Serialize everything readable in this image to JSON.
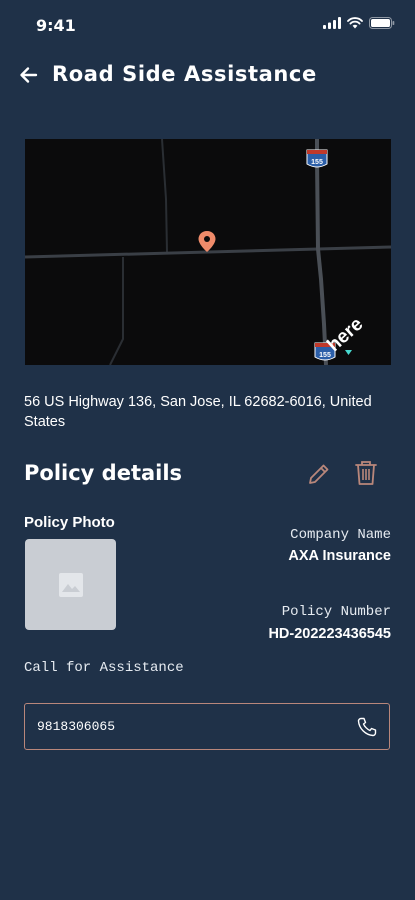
{
  "status_bar": {
    "time": "9:41"
  },
  "header": {
    "title": "Road Side Assistance"
  },
  "map": {
    "highway_shield_top": "155",
    "highway_shield_bottom": "155",
    "watermark": "here"
  },
  "address": "56 US Highway 136, San Jose, IL 62682-6016, United States",
  "policy": {
    "section_title": "Policy details",
    "photo_label": "Policy Photo",
    "company_label": "Company Name",
    "company_value": "AXA Insurance",
    "number_label": "Policy Number",
    "number_value": "HD-202223436545"
  },
  "assistance": {
    "label": "Call for Assistance",
    "phone": "9818306065"
  },
  "colors": {
    "background": "#1f3148",
    "accent": "#b9877b",
    "map_pin": "#ef8b6a"
  },
  "icons": [
    "signal-icon",
    "wifi-icon",
    "battery-icon",
    "back-arrow-icon",
    "map-pin-icon",
    "edit-icon",
    "delete-icon",
    "image-placeholder-icon",
    "phone-icon"
  ]
}
